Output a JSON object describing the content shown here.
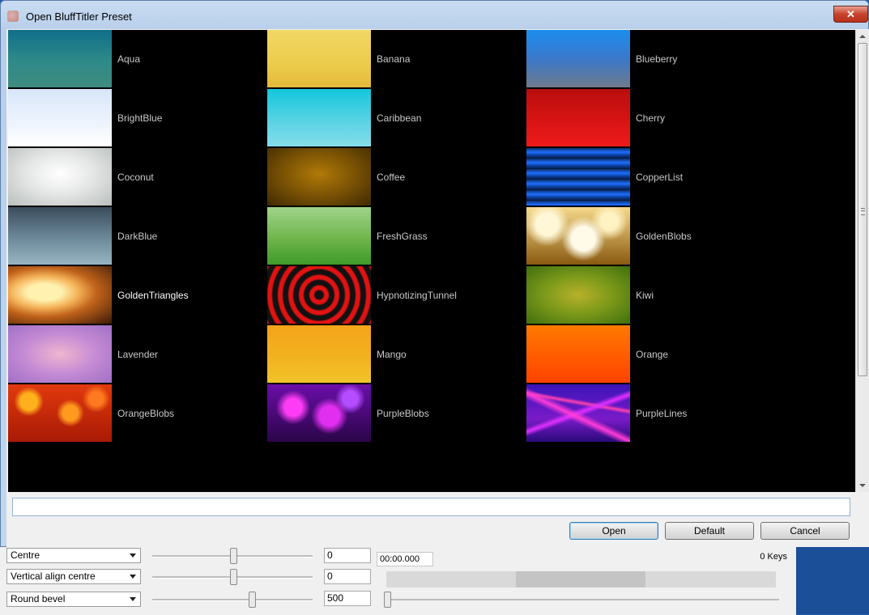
{
  "window": {
    "title": "Open BluffTitler Preset",
    "close_label": "✕"
  },
  "presets": [
    {
      "name": "Aqua",
      "bg": "linear-gradient(180deg,#0f6f8a 0%,#2f8a88 55%,#3f8b80 100%)"
    },
    {
      "name": "Banana",
      "bg": "linear-gradient(180deg,#f1d865 0%,#eccc4a 60%,#e5b83a 100%)"
    },
    {
      "name": "Blueberry",
      "bg": "linear-gradient(180deg,#1c8ef0 0%,#3a78c9 50%,#6f7a8c 100%)"
    },
    {
      "name": "BrightBlue",
      "bg": "linear-gradient(180deg,#d8e6fa 0%,#eef4fd 60%,#ffffff 100%)"
    },
    {
      "name": "Caribbean",
      "bg": "linear-gradient(180deg,#14c6dc 0%,#5dd4e5 60%,#86dde9 100%)"
    },
    {
      "name": "Cherry",
      "bg": "linear-gradient(180deg,#b80d0d 0%,#d51313 50%,#ee1a1a 100%)"
    },
    {
      "name": "Coconut",
      "bg": "radial-gradient(ellipse at 50% 45%,#ffffff 0%,#e5e7e6 45%,#b9bebc 100%)"
    },
    {
      "name": "Coffee",
      "bg": "radial-gradient(ellipse at 50% 45%,#b07a08 0%,#7a5204 50%,#3e2a03 100%)"
    },
    {
      "name": "CopperList",
      "bg": "repeating-linear-gradient(180deg,#0b2d6a 0px,#1f6fff 5px,#0b3d9a 9px,#061a3d 13px)"
    },
    {
      "name": "DarkBlue",
      "bg": "linear-gradient(180deg,#3b4c5c 0%,#6d8a9b 55%,#98b4c2 100%)"
    },
    {
      "name": "FreshGrass",
      "bg": "linear-gradient(180deg,#9fd38a 0%,#6fb54c 55%,#3f9a2a 100%)"
    },
    {
      "name": "GoldenBlobs",
      "bg": "radial-gradient(circle at 20% 30%,#fff7d6 0 12%,transparent 24%),radial-gradient(circle at 55% 55%,#fffbe8 0 18%,transparent 34%),radial-gradient(circle at 80% 25%,#fff3c4 0 9%,transparent 20%),linear-gradient(180deg,#f6d98a,#8a5a10)"
    },
    {
      "name": "GoldenTriangles",
      "bg": "radial-gradient(ellipse at 35% 45%,#fff2b0 0 18%,#f5b45a 35%,#c0621a 55%,#3a1a08 100%)"
    },
    {
      "name": "HypnotizingTunnel",
      "bg": "repeating-radial-gradient(circle at 50% 50%,#111 0px,#111 5px,#e31212 7px,#e31212 11px,#111 13px)"
    },
    {
      "name": "Kiwi",
      "bg": "radial-gradient(ellipse at 50% 50%,#b8b12a 0%,#7e9a1a 45%,#3f6f0e 100%)"
    },
    {
      "name": "Lavender",
      "bg": "radial-gradient(ellipse at 50% 50%,#f0b6cf 0%,#c48ad4 50%,#a070c6 100%)"
    },
    {
      "name": "Mango",
      "bg": "linear-gradient(180deg,#f4a41a 0%,#f2b21f 55%,#f1c42a 100%)"
    },
    {
      "name": "Orange",
      "bg": "linear-gradient(180deg,#ff7a00 0%,#ff5e00 50%,#ff4200 100%)"
    },
    {
      "name": "OrangeBlobs",
      "bg": "radial-gradient(circle at 20% 30%,#ffb11c 0 9%,transparent 16%),radial-gradient(circle at 60% 50%,#ff9a1e 0 11%,transparent 20%),radial-gradient(circle at 85% 25%,#ff7a1e 0 7%,transparent 14%),linear-gradient(180deg,#e23a0e,#a81a05)"
    },
    {
      "name": "PurpleBlobs",
      "bg": "radial-gradient(circle at 25% 40%,#ff3cf5 0 10%,transparent 20%),radial-gradient(circle at 60% 55%,#e12ff0 0 14%,transparent 26%),radial-gradient(circle at 80% 25%,#b44dff 0 8%,transparent 16%),linear-gradient(180deg,#6a0ea8,#2a0548)"
    },
    {
      "name": "PurpleLines",
      "bg": "linear-gradient(25deg,transparent 40%,#ff3cd8 46%,transparent 52%),linear-gradient(-20deg,transparent 45%,#e030ff 50%,transparent 55%),linear-gradient(10deg,transparent 60%,#ff40b0 64%,transparent 68%),linear-gradient(180deg,#3a14b8,#7a1ac8 60%,#2a0a7a)"
    }
  ],
  "selected_preset": "GoldenTriangles",
  "filename_value": "",
  "buttons": {
    "open": "Open",
    "default": "Default",
    "cancel": "Cancel"
  },
  "background_app": {
    "select1": "Centre",
    "select2": "Vertical align centre",
    "select3": "Round bevel",
    "value1": "0",
    "value2": "0",
    "value3": "500",
    "time": "00:00.000",
    "keys": "0 Keys"
  }
}
